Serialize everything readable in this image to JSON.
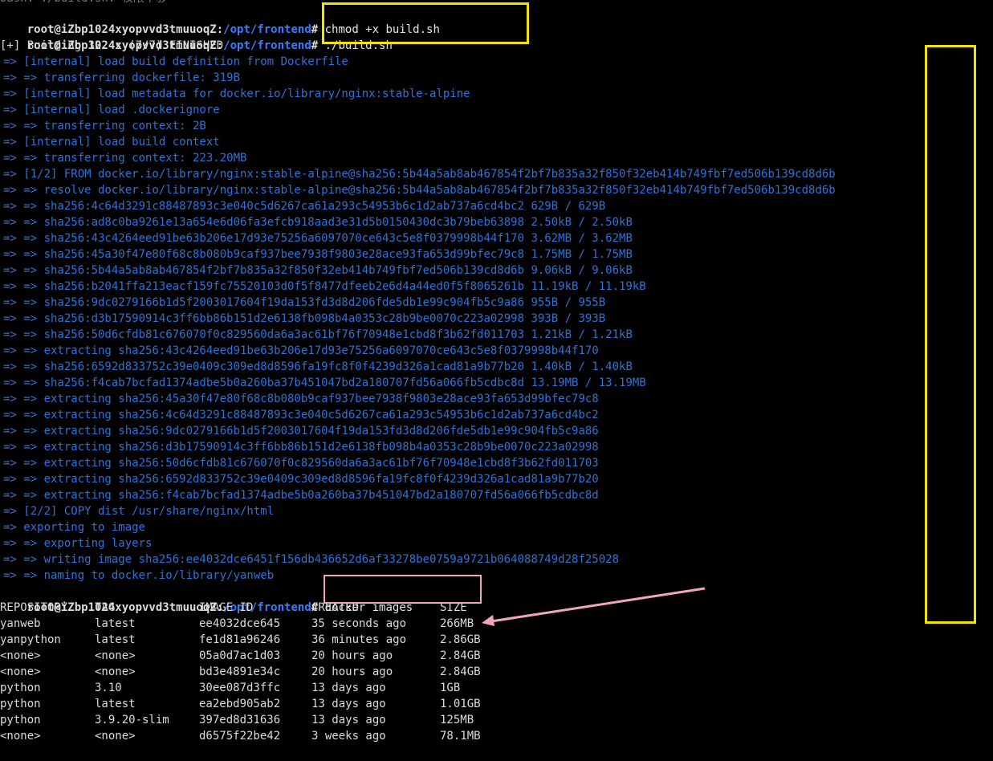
{
  "prompt": {
    "user_host": "root@iZbp1024xyopvvd3tmuuoqZ",
    "sep": ":",
    "path": "/opt/frontend",
    "symbol": "# "
  },
  "top_partial": "bash: ./build.sh: 权限不够",
  "commands": {
    "chmod": "chmod +x build.sh",
    "run": "./build.sh",
    "images": "docker images"
  },
  "build_header": "[+] Building 32.4s (7/7) FINISHED",
  "build_lines": [
    "=> [internal] load build definition from Dockerfile",
    "=> => transferring dockerfile: 319B",
    "=> [internal] load metadata for docker.io/library/nginx:stable-alpine",
    "=> [internal] load .dockerignore",
    "=> => transferring context: 2B",
    "=> [internal] load build context",
    "=> => transferring context: 223.20MB",
    "=> [1/2] FROM docker.io/library/nginx:stable-alpine@sha256:5b44a5ab8ab467854f2bf7b835a32f850f32eb414b749fbf7ed506b139cd8d6b",
    "=> => resolve docker.io/library/nginx:stable-alpine@sha256:5b44a5ab8ab467854f2bf7b835a32f850f32eb414b749fbf7ed506b139cd8d6b",
    "=> => sha256:4c64d3291c88487893c3e040c5d6267ca61a293c54953b6c1d2ab737a6cd4bc2 629B / 629B",
    "=> => sha256:ad8c0ba9261e13a654e6d06fa3efcb918aad3e31d5b0150430dc3b79beb63898 2.50kB / 2.50kB",
    "=> => sha256:43c4264eed91be63b206e17d93e75256a6097070ce643c5e8f0379998b44f170 3.62MB / 3.62MB",
    "=> => sha256:45a30f47e80f68c8b080b9caf937bee7938f9803e28ace93fa653d99bfec79c8 1.75MB / 1.75MB",
    "=> => sha256:5b44a5ab8ab467854f2bf7b835a32f850f32eb414b749fbf7ed506b139cd8d6b 9.06kB / 9.06kB",
    "=> => sha256:b2041ffa213eacf159fc75520103d0f5f8477dfeeb2e6d4a44ed0f5f8065261b 11.19kB / 11.19kB",
    "=> => sha256:9dc0279166b1d5f2003017604f19da153fd3d8d206fde5db1e99c904fb5c9a86 955B / 955B",
    "=> => sha256:d3b17590914c3ff6bb86b151d2e6138fb098b4a0353c28b9be0070c223a02998 393B / 393B",
    "=> => sha256:50d6cfdb81c676070f0c829560da6a3ac61bf76f70948e1cbd8f3b62fd011703 1.21kB / 1.21kB",
    "=> => extracting sha256:43c4264eed91be63b206e17d93e75256a6097070ce643c5e8f0379998b44f170",
    "=> => sha256:6592d833752c39e0409c309ed8d8596fa19fc8f0f4239d326a1cad81a9b77b20 1.40kB / 1.40kB",
    "=> => sha256:f4cab7bcfad1374adbe5b0a260ba37b451047bd2a180707fd56a066fb5cdbc8d 13.19MB / 13.19MB",
    "=> => extracting sha256:45a30f47e80f68c8b080b9caf937bee7938f9803e28ace93fa653d99bfec79c8",
    "=> => extracting sha256:4c64d3291c88487893c3e040c5d6267ca61a293c54953b6c1d2ab737a6cd4bc2",
    "=> => extracting sha256:9dc0279166b1d5f2003017604f19da153fd3d8d206fde5db1e99c904fb5c9a86",
    "=> => extracting sha256:d3b17590914c3ff6bb86b151d2e6138fb098b4a0353c28b9be0070c223a02998",
    "=> => extracting sha256:50d6cfdb81c676070f0c829560da6a3ac61bf76f70948e1cbd8f3b62fd011703",
    "=> => extracting sha256:6592d833752c39e0409c309ed8d8596fa19fc8f0f4239d326a1cad81a9b77b20",
    "=> => extracting sha256:f4cab7bcfad1374adbe5b0a260ba37b451047bd2a180707fd56a066fb5cdbc8d",
    "=> [2/2] COPY dist /usr/share/nginx/html",
    "=> exporting to image",
    "=> => exporting layers",
    "=> => writing image sha256:ee4032dce6451f156db436652d6af33278be0759a9721b064088749d28f25028",
    "=> => naming to docker.io/library/yanweb"
  ],
  "images_table": {
    "headers": [
      "REPOSITORY",
      "TAG",
      "IMAGE ID",
      "CREATED",
      "SIZE"
    ],
    "rows": [
      [
        "yanweb",
        "latest",
        "ee4032dce645",
        "35 seconds ago",
        "266MB"
      ],
      [
        "yanpython",
        "latest",
        "fe1d81a96246",
        "36 minutes ago",
        "2.86GB"
      ],
      [
        "<none>",
        "<none>",
        "05a0d7ac1d03",
        "20 hours ago",
        "2.84GB"
      ],
      [
        "<none>",
        "<none>",
        "bd3e4891e34c",
        "20 hours ago",
        "2.84GB"
      ],
      [
        "python",
        "3.10",
        "30ee087d3ffc",
        "13 days ago",
        "1GB"
      ],
      [
        "python",
        "latest",
        "ea2ebd905ab2",
        "13 days ago",
        "1.01GB"
      ],
      [
        "python",
        "3.9.20-slim",
        "397ed8d31636",
        "13 days ago",
        "125MB"
      ],
      [
        "<none>",
        "<none>",
        "d6575f22be42",
        "3 weeks ago",
        "78.1MB"
      ]
    ]
  },
  "colors": {
    "highlight_box": "#f2e300",
    "annotation": "#f0a6c2",
    "path": "#3b7cff",
    "build_text": "#2f72d8"
  }
}
